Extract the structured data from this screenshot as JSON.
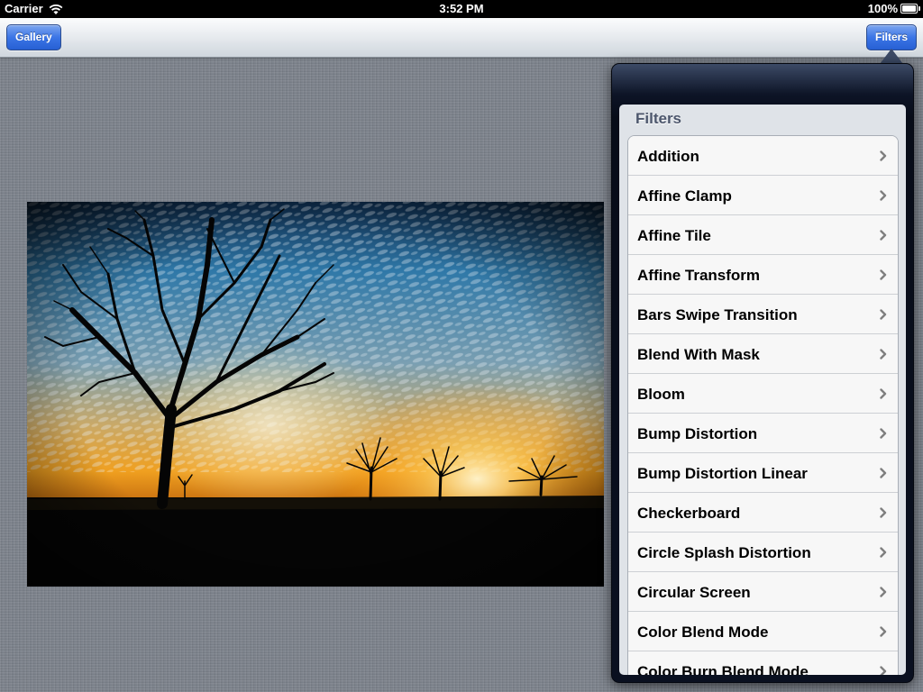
{
  "status_bar": {
    "carrier": "Carrier",
    "time": "3:52 PM",
    "battery": "100%",
    "icons": [
      "wifi-icon",
      "battery-icon"
    ]
  },
  "nav_bar": {
    "left_button": "Gallery",
    "right_button": "Filters"
  },
  "popover": {
    "section_header": "Filters",
    "items": [
      {
        "label": "Addition"
      },
      {
        "label": "Affine Clamp"
      },
      {
        "label": "Affine Tile"
      },
      {
        "label": "Affine Transform"
      },
      {
        "label": "Bars Swipe Transition"
      },
      {
        "label": "Blend With Mask"
      },
      {
        "label": "Bloom"
      },
      {
        "label": "Bump Distortion"
      },
      {
        "label": "Bump Distortion Linear"
      },
      {
        "label": "Checkerboard"
      },
      {
        "label": "Circle Splash Distortion"
      },
      {
        "label": "Circular Screen"
      },
      {
        "label": "Color Blend Mode"
      },
      {
        "label": "Color Burn Blend Mode"
      }
    ],
    "row_icon": "chevron-right-icon"
  },
  "colors": {
    "nav_button": "#3b75e6",
    "popover_dark": "#0d1426",
    "background": "#7d838c"
  }
}
